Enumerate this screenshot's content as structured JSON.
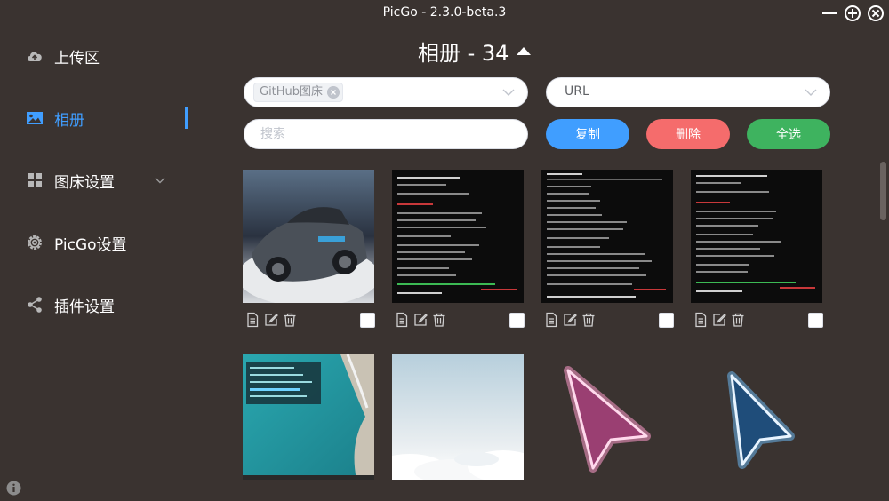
{
  "window": {
    "title": "PicGo - 2.3.0-beta.3"
  },
  "sidebar": {
    "items": [
      {
        "label": "上传区",
        "icon": "cloud-upload-icon"
      },
      {
        "label": "相册",
        "icon": "image-icon",
        "active": true
      },
      {
        "label": "图床设置",
        "icon": "grid-icon",
        "has_submenu": true
      },
      {
        "label": "PicGo设置",
        "icon": "gear-icon"
      },
      {
        "label": "插件设置",
        "icon": "share-icon"
      }
    ]
  },
  "gallery": {
    "heading": "相册 - 34",
    "picbed_filter": {
      "tag": "GitHub图床"
    },
    "url_format": {
      "value": "URL"
    },
    "search": {
      "placeholder": "搜索",
      "value": ""
    },
    "buttons": {
      "copy": "复制",
      "delete": "删除",
      "select_all": "全选"
    },
    "items": [
      {
        "thumb": "car-photo",
        "checked": false
      },
      {
        "thumb": "terminal-screenshot",
        "checked": false
      },
      {
        "thumb": "terminal-screenshot",
        "checked": false
      },
      {
        "thumb": "terminal-screenshot",
        "checked": false
      },
      {
        "thumb": "aerial-sea-screenshot"
      },
      {
        "thumb": "sky-clouds-photo"
      },
      {
        "thumb": "pink-cursor-arrow"
      },
      {
        "thumb": "blue-cursor-arrow"
      }
    ]
  },
  "colors": {
    "background": "#3a3330",
    "accent": "#409eff",
    "danger": "#f56c6c",
    "success": "#3eb35f"
  }
}
